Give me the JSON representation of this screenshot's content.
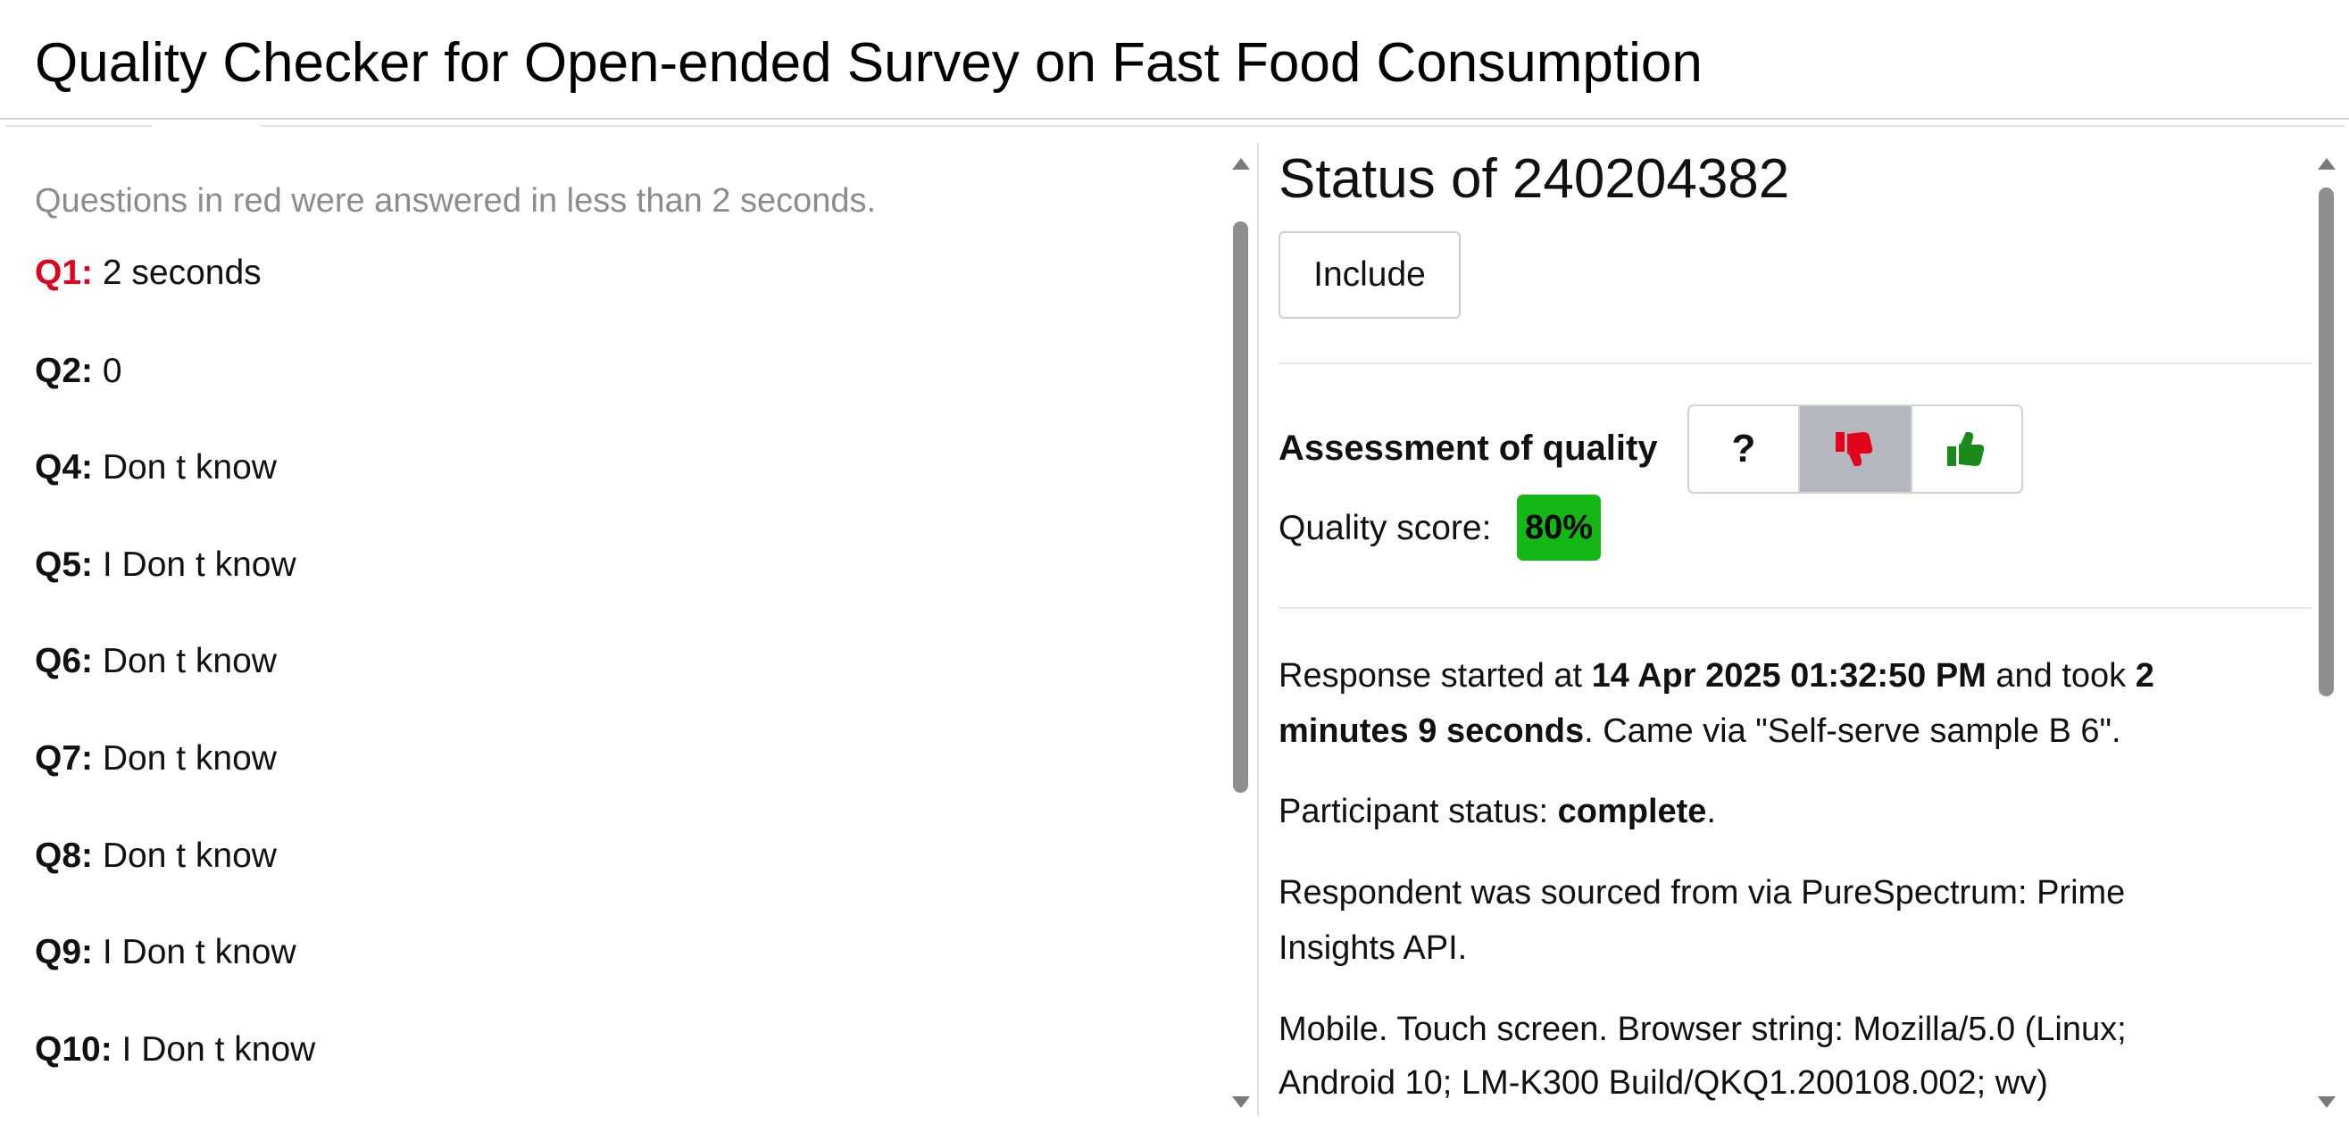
{
  "header": {
    "title": "Quality Checker for Open-ended Survey on Fast Food Consumption"
  },
  "left": {
    "note": "Questions in red were answered in less than 2 seconds.",
    "answers": [
      {
        "label": "Q1:",
        "answer": "2 seconds",
        "fast": true
      },
      {
        "label": "Q2:",
        "answer": "0",
        "fast": false
      },
      {
        "label": "Q4:",
        "answer": "Don t know",
        "fast": false
      },
      {
        "label": "Q5:",
        "answer": "I Don t know",
        "fast": false
      },
      {
        "label": "Q6:",
        "answer": "Don t know",
        "fast": false
      },
      {
        "label": "Q7:",
        "answer": "Don t know",
        "fast": false
      },
      {
        "label": "Q8:",
        "answer": "Don t know",
        "fast": false
      },
      {
        "label": "Q9:",
        "answer": "I Don t know",
        "fast": false
      },
      {
        "label": "Q10:",
        "answer": "I Don t know",
        "fast": false
      }
    ]
  },
  "right": {
    "status_title": "Status of 240204382",
    "include_label": "Include",
    "assessment_label": "Assessment of quality",
    "assessment_options": [
      {
        "icon": "question-mark-icon",
        "glyph": "?",
        "selected": false
      },
      {
        "icon": "thumbs-down-icon",
        "color": "#e3001b",
        "selected": true
      },
      {
        "icon": "thumbs-up-icon",
        "color": "#1a8a1a",
        "selected": false
      }
    ],
    "quality_score_label": "Quality score:",
    "quality_score_value": "80%",
    "quality_score_color": "#14b814",
    "response": {
      "prefix": "Response started at ",
      "started_at": "14 Apr 2025 01:32:50 PM",
      "middle": " and took ",
      "duration_line1": "2",
      "duration_line2": "minutes 9 seconds",
      "suffix": ". Came via \"Self-serve sample B 6\"."
    },
    "participant": {
      "prefix": "Participant status: ",
      "status": "complete",
      "suffix": "."
    },
    "source_line1": "Respondent was sourced from via PureSpectrum: Prime",
    "source_line2": "Insights API.",
    "device_line1": "Mobile. Touch screen. Browser string: Mozilla/5.0 (Linux;",
    "device_line2": "Android 10; LM-K300 Build/QKQ1.200108.002; wv)"
  },
  "colors": {
    "fast_answer_red": "#e3001b",
    "selected_segment": "#b3b8be"
  }
}
